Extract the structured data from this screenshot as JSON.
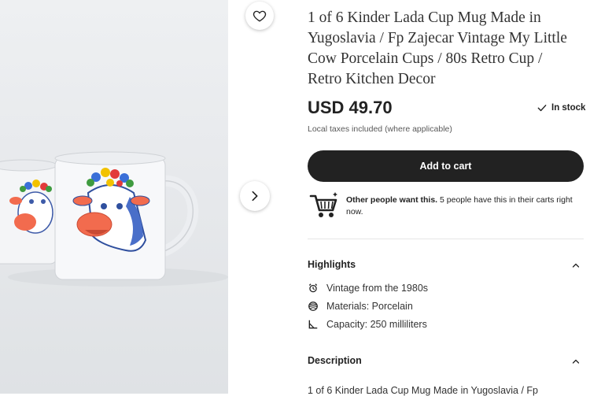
{
  "product": {
    "title": "1 of 6 Kinder Lada Cup Mug Made in Yugoslavia / Fp Zajecar Vintage My Little Cow Porcelain Cups / 80s Retro Cup / Retro Kitchen Decor",
    "price": "USD 49.70",
    "stock": "In stock",
    "taxes_note": "Local taxes included (where applicable)"
  },
  "cart": {
    "button_label": "Add to cart"
  },
  "demand": {
    "bold": "Other people want this.",
    "rest": " 5 people have this in their carts right now."
  },
  "highlights": {
    "heading": "Highlights",
    "items": [
      {
        "icon": "vintage-icon",
        "label": "Vintage from the 1980s"
      },
      {
        "icon": "material-icon",
        "label": "Materials: Porcelain"
      },
      {
        "icon": "capacity-icon",
        "label": "Capacity: 250 milliliters"
      }
    ]
  },
  "description": {
    "heading": "Description",
    "text": "1 of 6 Kinder Lada Cup Mug Made in Yugoslavia / Fp"
  },
  "icons": {
    "favorite": "heart-icon",
    "next_image": "chevron-right-icon",
    "stock": "check-icon",
    "cart": "shopping-cart-icon",
    "collapse": "chevron-up-icon"
  },
  "colors": {
    "button_bg": "#222222",
    "button_text": "#ffffff",
    "text": "#222222",
    "muted": "#595959",
    "divider": "#e6e6e6",
    "cow_nose": "#f26b4e",
    "cow_blue": "#4a6fc9"
  }
}
